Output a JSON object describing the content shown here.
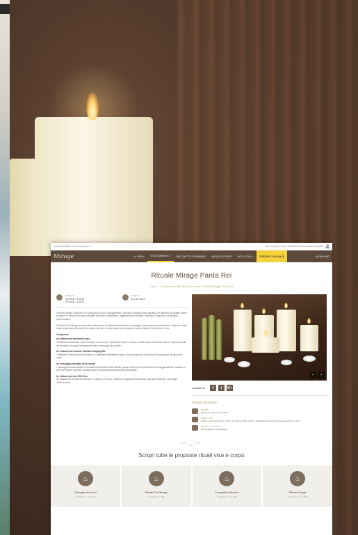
{
  "topbar": {
    "contact": "+39 0999 999999 • info@miragegroup.it",
    "notice": "Sei una parrucchiera o un'Estetista? Accedi all'area personale",
    "user_icon": "user-icon"
  },
  "nav": {
    "logo": "Mirage",
    "items": [
      {
        "label": "LA SPA ∨"
      },
      {
        "label": "TRATTAMENTI ∨"
      },
      {
        "label": "PACCHETTI COMBINATI"
      },
      {
        "label": "NEWS & EVENTI"
      },
      {
        "label": "INFO UTILI ∨"
      },
      {
        "label": "CERTIFIC.VACANZE"
      }
    ],
    "language": "⊕ ITALIANO"
  },
  "page": {
    "title": "Rituale Mirage Panta Rei",
    "breadcrumb": "Home > Trattamenti > Rituali viso e corpo > Rituali Mirage Panta Rei"
  },
  "info": {
    "price_label": "PREZZO",
    "price_value_1": "30 minuti – € 35,00",
    "price_value_2": "60 minuti – € 60,00",
    "duration_label": "DURATA",
    "duration_value": "30 o 60 minuti"
  },
  "body": {
    "p1": "Il Rituale Mirage Panta Rei è un programma di puro appagamento, completo e studiato nello specifico per riattivare gli equilibri interni, sciogliere le tensioni e donare una pelle luminosa e rivitalizzata, migliorandone la tonicità, illuminare l'incarnato e prolungare l'abbronzatura.",
    "p2": "Il Rituale Over Mirage prevede alla combinazione di trattamenti di bellezza, massaggi e trattamenti drenanti intensivi, migliora lo stato l'aspetto generale della pelle del corpo e del viso e in più regala una sensazione unica e totale di benessere e relax.",
    "h1": "Comprende:",
    "h2": "Un trattamento esfoliante corpo",
    "p3": "Il trattamento esfoliante corpo è ideale per rinnovare e rigenerare la pelle, elimina le cellule morte e tonifica il derma. Prepara la pelle ad accogliere al meglio trattamenti beauty e massaggi più specifici.",
    "h3": "Un trattamento drenante Equilibri Gauging Bar",
    "p4": "I trattamenti drenanti Equilibri aiutano a combattere inestetismi e pelle a buccia d'arancia, favorendo la circolazione dei liquidi nel corpo.",
    "h4": "Un massaggio drenante da 30 minuti",
    "p5": "I massaggi drenanti aiutano a combattere inestetismi della cellulite, grazie all'azione dei movimenti di drenaggio linfatico, aiutando a prevenire edemi e gonfiori, alleggerendo la sensazione di stanchezza sulle gambe.",
    "h5": "Un trattamento viso Effet Sun",
    "p6": "Un trattamento di bellezza intensivo e nutriente per il viso. Illumina, rinvigorisce l'idratazione della pelle intensivo e prolunga l'abbronzatura."
  },
  "share": {
    "label": "condividi su",
    "facebook": "f",
    "twitter": "t",
    "google": "G+"
  },
  "details": {
    "title": "Dettagli trattamento",
    "benefit_label": "BENEFIT",
    "benefit_value": "Ideale per alleviare le tensioni.",
    "skin_label": "IDEALE PER",
    "skin_value": "Adatto a tutti i tipi di pelle, ideale per pelli sensibili, secche, disidratate da una prolungata esposizione solare.",
    "product_label": "PRODOTTI UTILIZZATI",
    "product_value": "Olio di jojoba e oli essenziali"
  },
  "discover": {
    "title": "Scopri tutte le proposte rituali viso e corpo",
    "divider": "⌒〰⌒"
  },
  "cards": [
    {
      "name": "Risveglio dei sensi",
      "sub": "3 trattamenti – da 100€"
    },
    {
      "name": "Rituale Dad Mirage",
      "sub": "4 trattamenti – 95€"
    },
    {
      "name": "Tranquility Welcome",
      "sub": "3 trattamenti – da 160€"
    },
    {
      "name": "Rituale Visage",
      "sub": "3 trattamenti – da 100€"
    }
  ],
  "colors": {
    "accent": "#f3d23a",
    "nav_bg": "#5b4a3c",
    "gold_text": "#b09a6e"
  }
}
